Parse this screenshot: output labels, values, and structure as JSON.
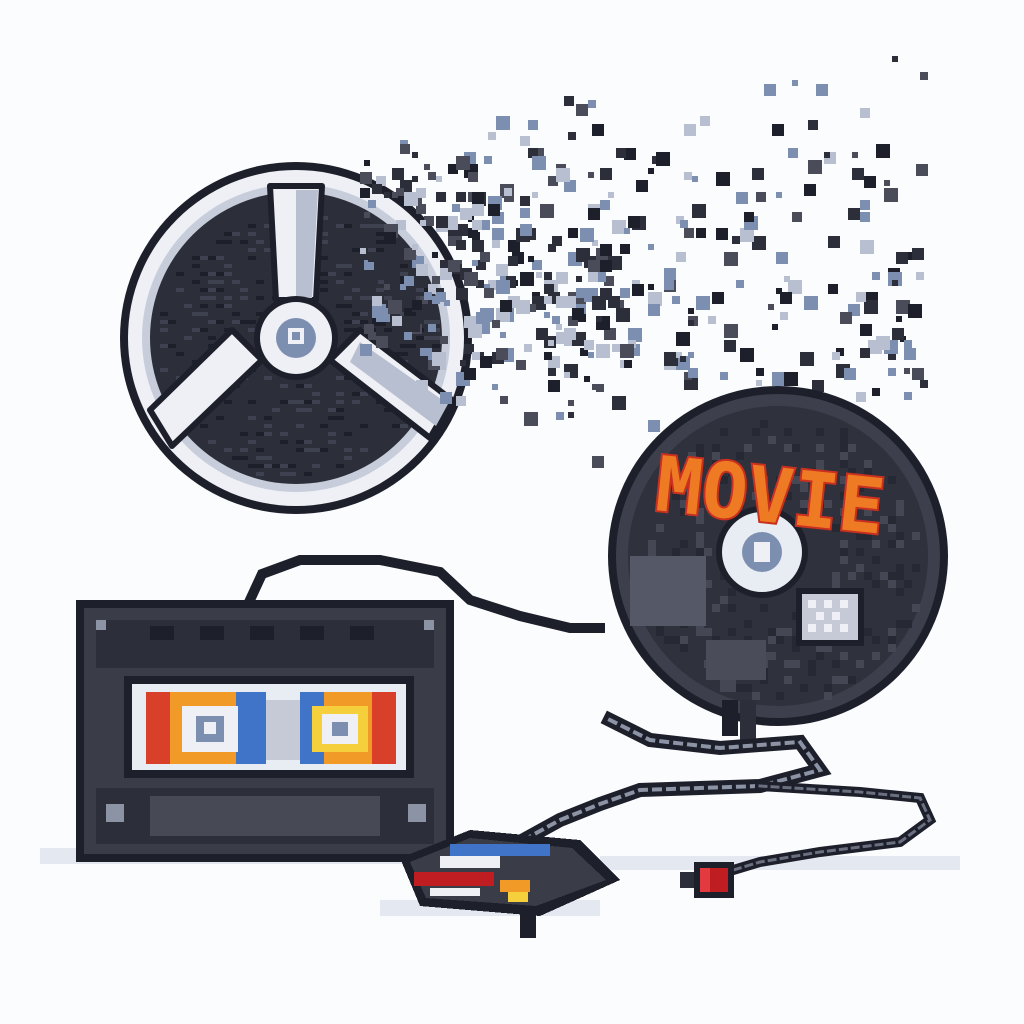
{
  "scene": {
    "background": "#fbfcfe",
    "palette": {
      "outline": "#1d1f2b",
      "dark": "#2c2e3a",
      "mid": "#4a4c59",
      "reel_white": "#eef0f5",
      "reel_shadow": "#b8bfd0",
      "hub_blue": "#7d8fb0",
      "label_red": "#d8402a",
      "label_orange": "#f19a28",
      "label_yellow": "#f6cf3c",
      "label_blue": "#3f74c9",
      "title_red": "#c9301f",
      "title_orange": "#ee7a24",
      "title_yellow": "#f4b83a",
      "plug_red": "#c01d23",
      "floor_shadow": "#dfe5ee"
    },
    "objects": [
      {
        "name": "film-reel",
        "icon": "film-reel-icon"
      },
      {
        "name": "pixel-dissolve-particles",
        "icon": "pixel-scatter"
      },
      {
        "name": "movie-disc",
        "icon": "disc-icon",
        "label": "MOVIE"
      },
      {
        "name": "vhs-cassette",
        "icon": "cassette-icon"
      },
      {
        "name": "film-strip-cable",
        "icon": "cable-icon"
      },
      {
        "name": "game-cartridge",
        "icon": "cartridge-icon"
      },
      {
        "name": "red-plug",
        "icon": "plug-icon"
      }
    ]
  }
}
